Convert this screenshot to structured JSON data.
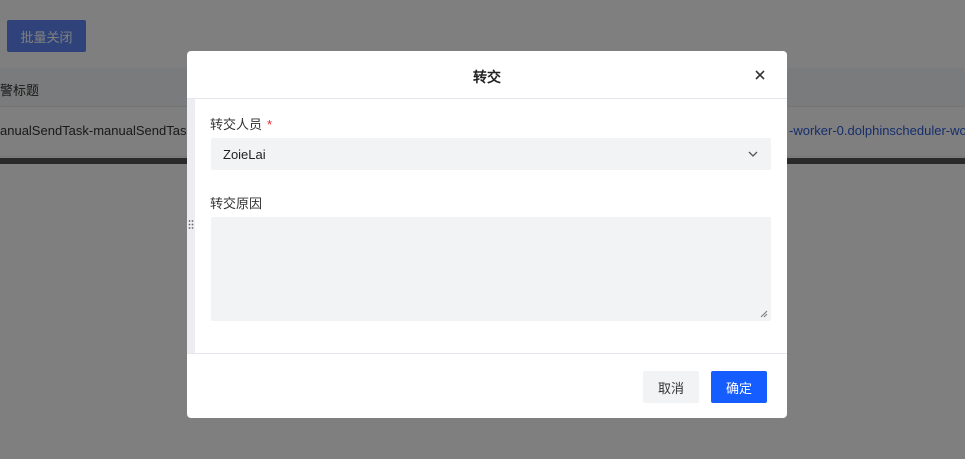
{
  "background": {
    "batch_close_button": "批量关闭",
    "table_header_title": "警标题",
    "row_left_text": "anualSendTask-manualSendTask-",
    "row_right_text": "-worker-0.dolphinscheduler-wo"
  },
  "dialog": {
    "title": "转交",
    "assignee": {
      "label": "转交人员",
      "required_mark": "*",
      "value": "ZoieLai"
    },
    "reason": {
      "label": "转交原因",
      "value": ""
    },
    "cancel_label": "取消",
    "ok_label": "确定"
  },
  "colors": {
    "primary": "#165dff",
    "required": "#f5222d",
    "input_bg": "#f2f3f5",
    "link": "#2b5cd8"
  },
  "icons": {
    "close": "close-icon",
    "select_arrow": "chevron-down-icon",
    "drag": "drag-handle-icon",
    "resize": "resize-grip-icon"
  }
}
